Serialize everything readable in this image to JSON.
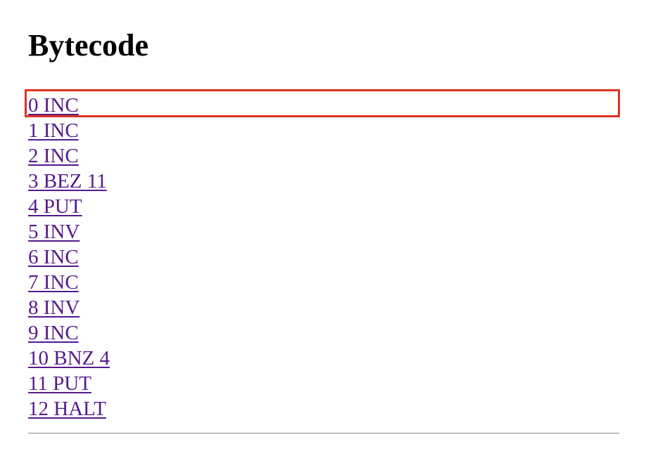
{
  "page": {
    "title": "Bytecode",
    "link_color": "#551a8b",
    "highlight_color": "#e0331f"
  },
  "instructions": [
    {
      "label": "0 INC"
    },
    {
      "label": "1 INC"
    },
    {
      "label": "2 INC"
    },
    {
      "label": "3 BEZ 11"
    },
    {
      "label": "4 PUT"
    },
    {
      "label": "5 INV"
    },
    {
      "label": "6 INC"
    },
    {
      "label": "7 INC"
    },
    {
      "label": "8 INV"
    },
    {
      "label": "9 INC"
    },
    {
      "label": "10 BNZ 4"
    },
    {
      "label": "11 PUT"
    },
    {
      "label": "12 HALT"
    }
  ],
  "highlighted_index": 0
}
